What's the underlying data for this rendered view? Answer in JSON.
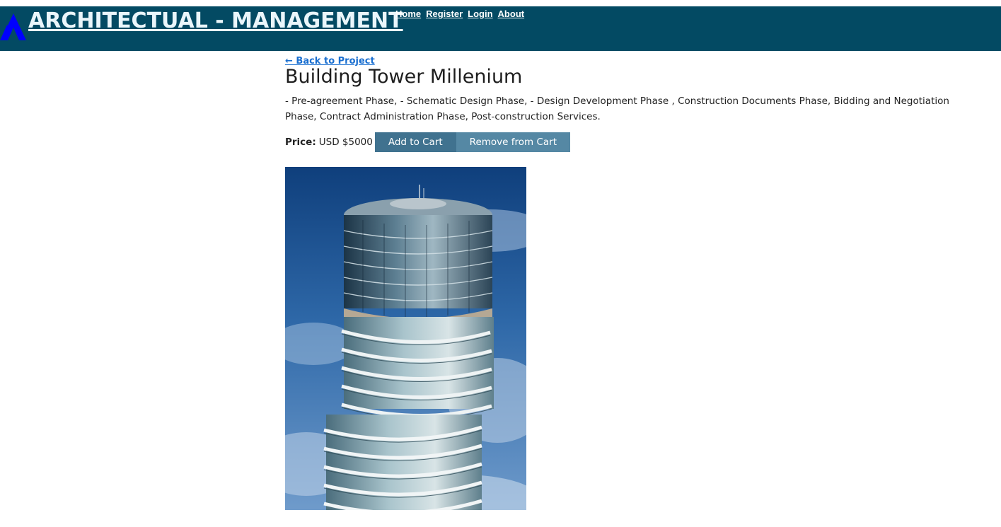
{
  "header": {
    "site_title": " ARCHITECTUAL - MANAGEMENT",
    "nav": [
      "Home",
      "Register",
      "Login",
      "About"
    ]
  },
  "product": {
    "back_link": "← Back to Project",
    "title": "Building Tower Millenium",
    "description": "- Pre-agreement Phase, - Schematic Design Phase, - Design Development Phase , Construction Documents Phase, Bidding and Negotiation Phase, Contract Administration Phase, Post-construction Services.",
    "price_label": "Price:",
    "price_value": "USD $5000",
    "add_to_cart": "Add to Cart",
    "remove_from_cart": "Remove from Cart"
  },
  "colors": {
    "header_bg": "#034a63",
    "logo": "#0000ff",
    "button_add": "#40728f",
    "button_remove": "#5588a4",
    "link": "#1a6fd0"
  },
  "icons": {
    "logo": "logo-triangle-icon"
  }
}
